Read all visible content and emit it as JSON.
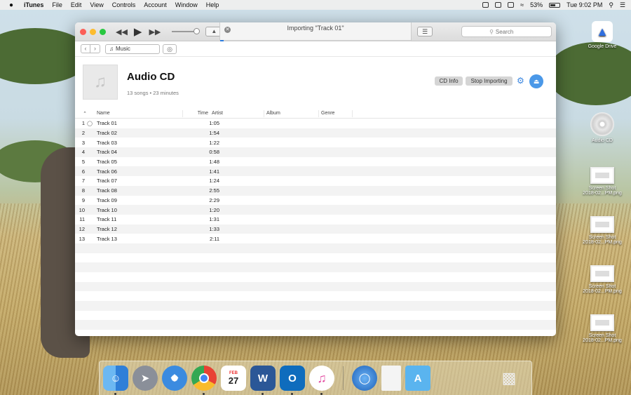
{
  "menubar": {
    "apple": "",
    "items": [
      "iTunes",
      "File",
      "Edit",
      "View",
      "Controls",
      "Account",
      "Window",
      "Help"
    ],
    "battery": "53%",
    "clock": "Tue 9:02 PM"
  },
  "window": {
    "status": "Importing \"Track 01\"",
    "import_progress_percent": 2,
    "search_placeholder": "Search",
    "library_selector": "Music"
  },
  "album": {
    "title": "Audio CD",
    "subtitle": "13 songs • 23 minutes",
    "cd_info_label": "CD Info",
    "stop_importing_label": "Stop Importing"
  },
  "table": {
    "columns": [
      "Name",
      "Time",
      "Artist",
      "Album",
      "Genre"
    ],
    "rows": [
      {
        "num": "1",
        "name": "Track 01",
        "time": "1:05"
      },
      {
        "num": "2",
        "name": "Track 02",
        "time": "1:54"
      },
      {
        "num": "3",
        "name": "Track 03",
        "time": "1:22"
      },
      {
        "num": "4",
        "name": "Track 04",
        "time": "0:58"
      },
      {
        "num": "5",
        "name": "Track 05",
        "time": "1:48"
      },
      {
        "num": "6",
        "name": "Track 06",
        "time": "1:41"
      },
      {
        "num": "7",
        "name": "Track 07",
        "time": "1:24"
      },
      {
        "num": "8",
        "name": "Track 08",
        "time": "2:55"
      },
      {
        "num": "9",
        "name": "Track 09",
        "time": "2:29"
      },
      {
        "num": "10",
        "name": "Track 10",
        "time": "1:20"
      },
      {
        "num": "11",
        "name": "Track 11",
        "time": "1:31"
      },
      {
        "num": "12",
        "name": "Track 12",
        "time": "1:33"
      },
      {
        "num": "13",
        "name": "Track 13",
        "time": "2:11"
      }
    ]
  },
  "desktop": {
    "google_drive": "Google Drive",
    "audio_cd": "Audio CD",
    "shot_line1": "Screen Shot",
    "shot_line2": "2018-02...PM.png"
  },
  "dock": {
    "calendar_month": "FEB",
    "calendar_day": "27"
  },
  "colors": {
    "accent": "#2b7bde",
    "eject": "#4a98e8"
  }
}
